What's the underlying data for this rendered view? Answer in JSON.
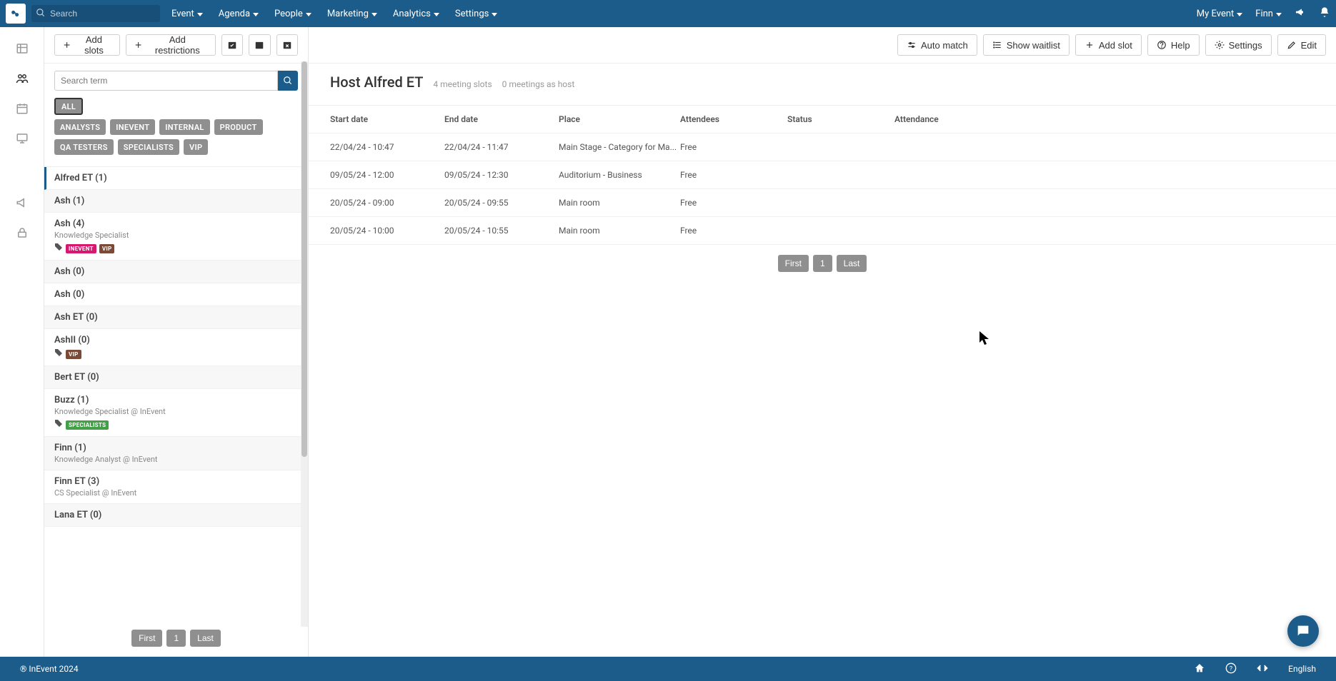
{
  "topnav": {
    "search_placeholder": "Search",
    "menu": [
      "Event",
      "Agenda",
      "People",
      "Marketing",
      "Analytics",
      "Settings"
    ],
    "right": {
      "my_event": "My Event",
      "user": "Finn"
    }
  },
  "left_toolbar": {
    "add_slots": "Add slots",
    "add_restrictions": "Add restrictions"
  },
  "right_toolbar": {
    "auto_match": "Auto match",
    "show_waitlist": "Show waitlist",
    "add_slot": "Add slot",
    "help": "Help",
    "settings": "Settings",
    "edit": "Edit"
  },
  "search": {
    "placeholder": "Search term"
  },
  "filters": {
    "all": "ALL",
    "tags": [
      "ANALYSTS",
      "INEVENT",
      "INTERNAL",
      "PRODUCT",
      "QA TESTERS",
      "SPECIALISTS",
      "VIP"
    ]
  },
  "people": [
    {
      "name": "Alfred ET (1)",
      "selected": true
    },
    {
      "name": "Ash (1)",
      "alt": true
    },
    {
      "name": "Ash (4)",
      "role": "Knowledge Specialist",
      "tags": [
        {
          "label": "INEVENT",
          "cls": "pink"
        },
        {
          "label": "VIP",
          "cls": "brown"
        }
      ]
    },
    {
      "name": "Ash (0)",
      "alt": true
    },
    {
      "name": "Ash (0)"
    },
    {
      "name": "Ash ET (0)",
      "alt": true
    },
    {
      "name": "AshII (0)",
      "tags": [
        {
          "label": "VIP",
          "cls": "brown"
        }
      ]
    },
    {
      "name": "Bert ET (0)",
      "alt": true
    },
    {
      "name": "Buzz (1)",
      "role": "Knowledge Specialist @ InEvent",
      "tags": [
        {
          "label": "SPECIALISTS",
          "cls": "green"
        }
      ]
    },
    {
      "name": "Finn (1)",
      "alt": true,
      "role": "Knowledge Analyst @ InEvent"
    },
    {
      "name": "Finn ET (3)",
      "role": "CS Specialist @ InEvent"
    },
    {
      "name": "Lana ET (0)",
      "alt": true
    }
  ],
  "left_pagination": {
    "first": "First",
    "page": "1",
    "last": "Last"
  },
  "detail": {
    "title": "Host Alfred ET",
    "slots": "4 meeting slots",
    "host": "0 meetings as host"
  },
  "table": {
    "headers": {
      "start": "Start date",
      "end": "End date",
      "place": "Place",
      "attendees": "Attendees",
      "status": "Status",
      "attendance": "Attendance"
    },
    "rows": [
      {
        "start": "22/04/24 - 10:47",
        "end": "22/04/24 - 11:47",
        "place": "Main Stage - Category for Ma...",
        "attendees": "Free",
        "status": "",
        "attendance": ""
      },
      {
        "start": "09/05/24 - 12:00",
        "end": "09/05/24 - 12:30",
        "place": "Auditorium - Business",
        "attendees": "Free",
        "status": "",
        "attendance": ""
      },
      {
        "start": "20/05/24 - 09:00",
        "end": "20/05/24 - 09:55",
        "place": "Main room",
        "attendees": "Free",
        "status": "",
        "attendance": ""
      },
      {
        "start": "20/05/24 - 10:00",
        "end": "20/05/24 - 10:55",
        "place": "Main room",
        "attendees": "Free",
        "status": "",
        "attendance": ""
      }
    ]
  },
  "right_pagination": {
    "first": "First",
    "page": "1",
    "last": "Last"
  },
  "footer": {
    "copyright": "® InEvent 2024",
    "lang": "English"
  }
}
